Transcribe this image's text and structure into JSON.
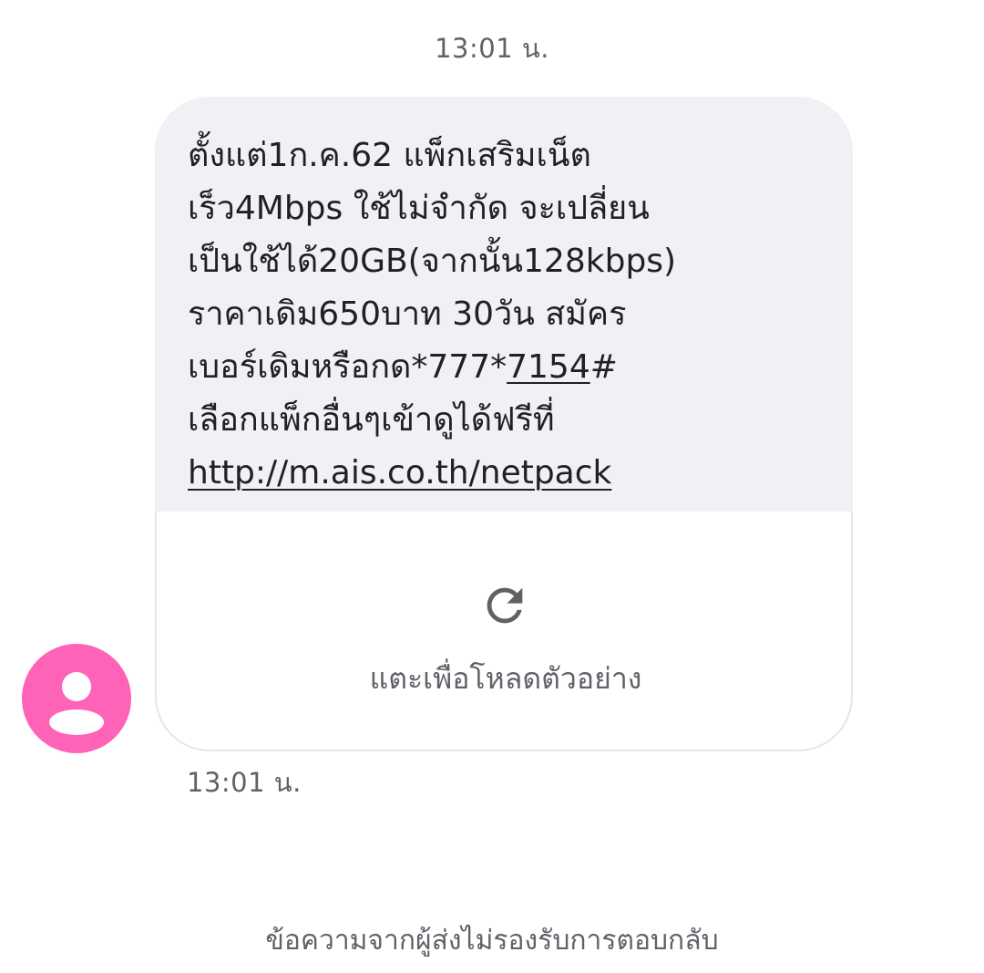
{
  "conversation": {
    "timestamp_top": "13:01 น.",
    "timestamp_bottom": "13:01 น.",
    "no_reply_notice": "ข้อความจากผู้ส่งไม่รองรับการตอบกลับ"
  },
  "message": {
    "lines": [
      "ตั้งแต่1ก.ค.62 แพ็กเสริมเน็ต",
      "เร็ว4Mbps ใช้ไม่จำกัด จะเปลี่ยน",
      "เป็นใช้ได้20GB(จากนั้น128kbps)",
      "ราคาเดิม650บาท 30วัน สมัคร"
    ],
    "line5_prefix": "เบอร์เดิมหรือกด*777*",
    "line5_underlined": "7154",
    "line5_suffix": "#",
    "line6": "เลือกแพ็กอื่นๆเข้าดูได้ฟรีที่",
    "link_text": "http://m.ais.co.th/netpack"
  },
  "link_preview": {
    "icon": "reload-icon",
    "label": "แตะเพื่อโหลดตัวอย่าง"
  },
  "avatar": {
    "icon": "person-icon",
    "color": "#ff63b8"
  }
}
